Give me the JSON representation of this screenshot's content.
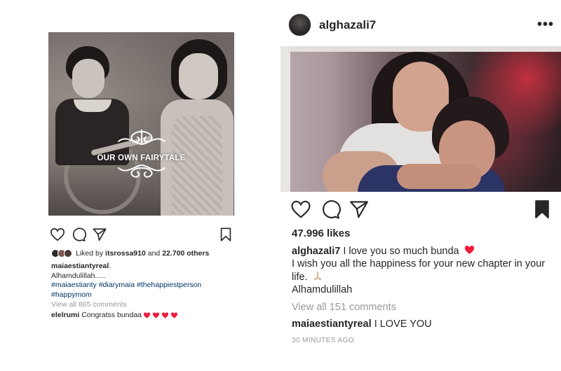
{
  "left_post": {
    "photo_overlay_text": "OUR OWN FAIRYTALE",
    "liked_by_prefix": "Liked by",
    "liked_by_user": "itsrossa910",
    "liked_by_and": "and",
    "liked_by_others": "22.700 others",
    "caption_user": "maiaestiantyreal",
    "caption_user_suffix": ".",
    "caption_text": "Alhamdulillah.....",
    "hashtags": [
      "#maiaestianty",
      "#diarymaia",
      "#thehappiestperson",
      "#happymom"
    ],
    "view_all_comments": "View all 865 comments",
    "comment_user": "elelrumi",
    "comment_text": "Congratss bundaa",
    "avatar_colors": [
      "#2b2b2b",
      "#7a5a4c",
      "#4a3a36"
    ]
  },
  "right_post": {
    "username": "alghazali7",
    "more_icon": "•••",
    "likes": "47.996 likes",
    "caption_user": "alghazali7",
    "caption_line1": "I love you so much bunda",
    "caption_line2": "I wish you all the happiness for your new chapter in your life.",
    "caption_line3": "Alhamdulillah",
    "view_all_comments": "View all 151 comments",
    "comment_user": "maiaestiantyreal",
    "comment_text": "I LOVE YOU",
    "timestamp": "30 MINUTES AGO"
  },
  "colors": {
    "heart_red": "#ed1b3c",
    "muted_text": "#999999",
    "hashtag_blue": "#003569",
    "text": "#262626"
  },
  "icons": {
    "like": "heart-outline-icon",
    "comment": "speech-bubble-icon",
    "share": "paper-plane-icon",
    "save": "bookmark-icon"
  }
}
